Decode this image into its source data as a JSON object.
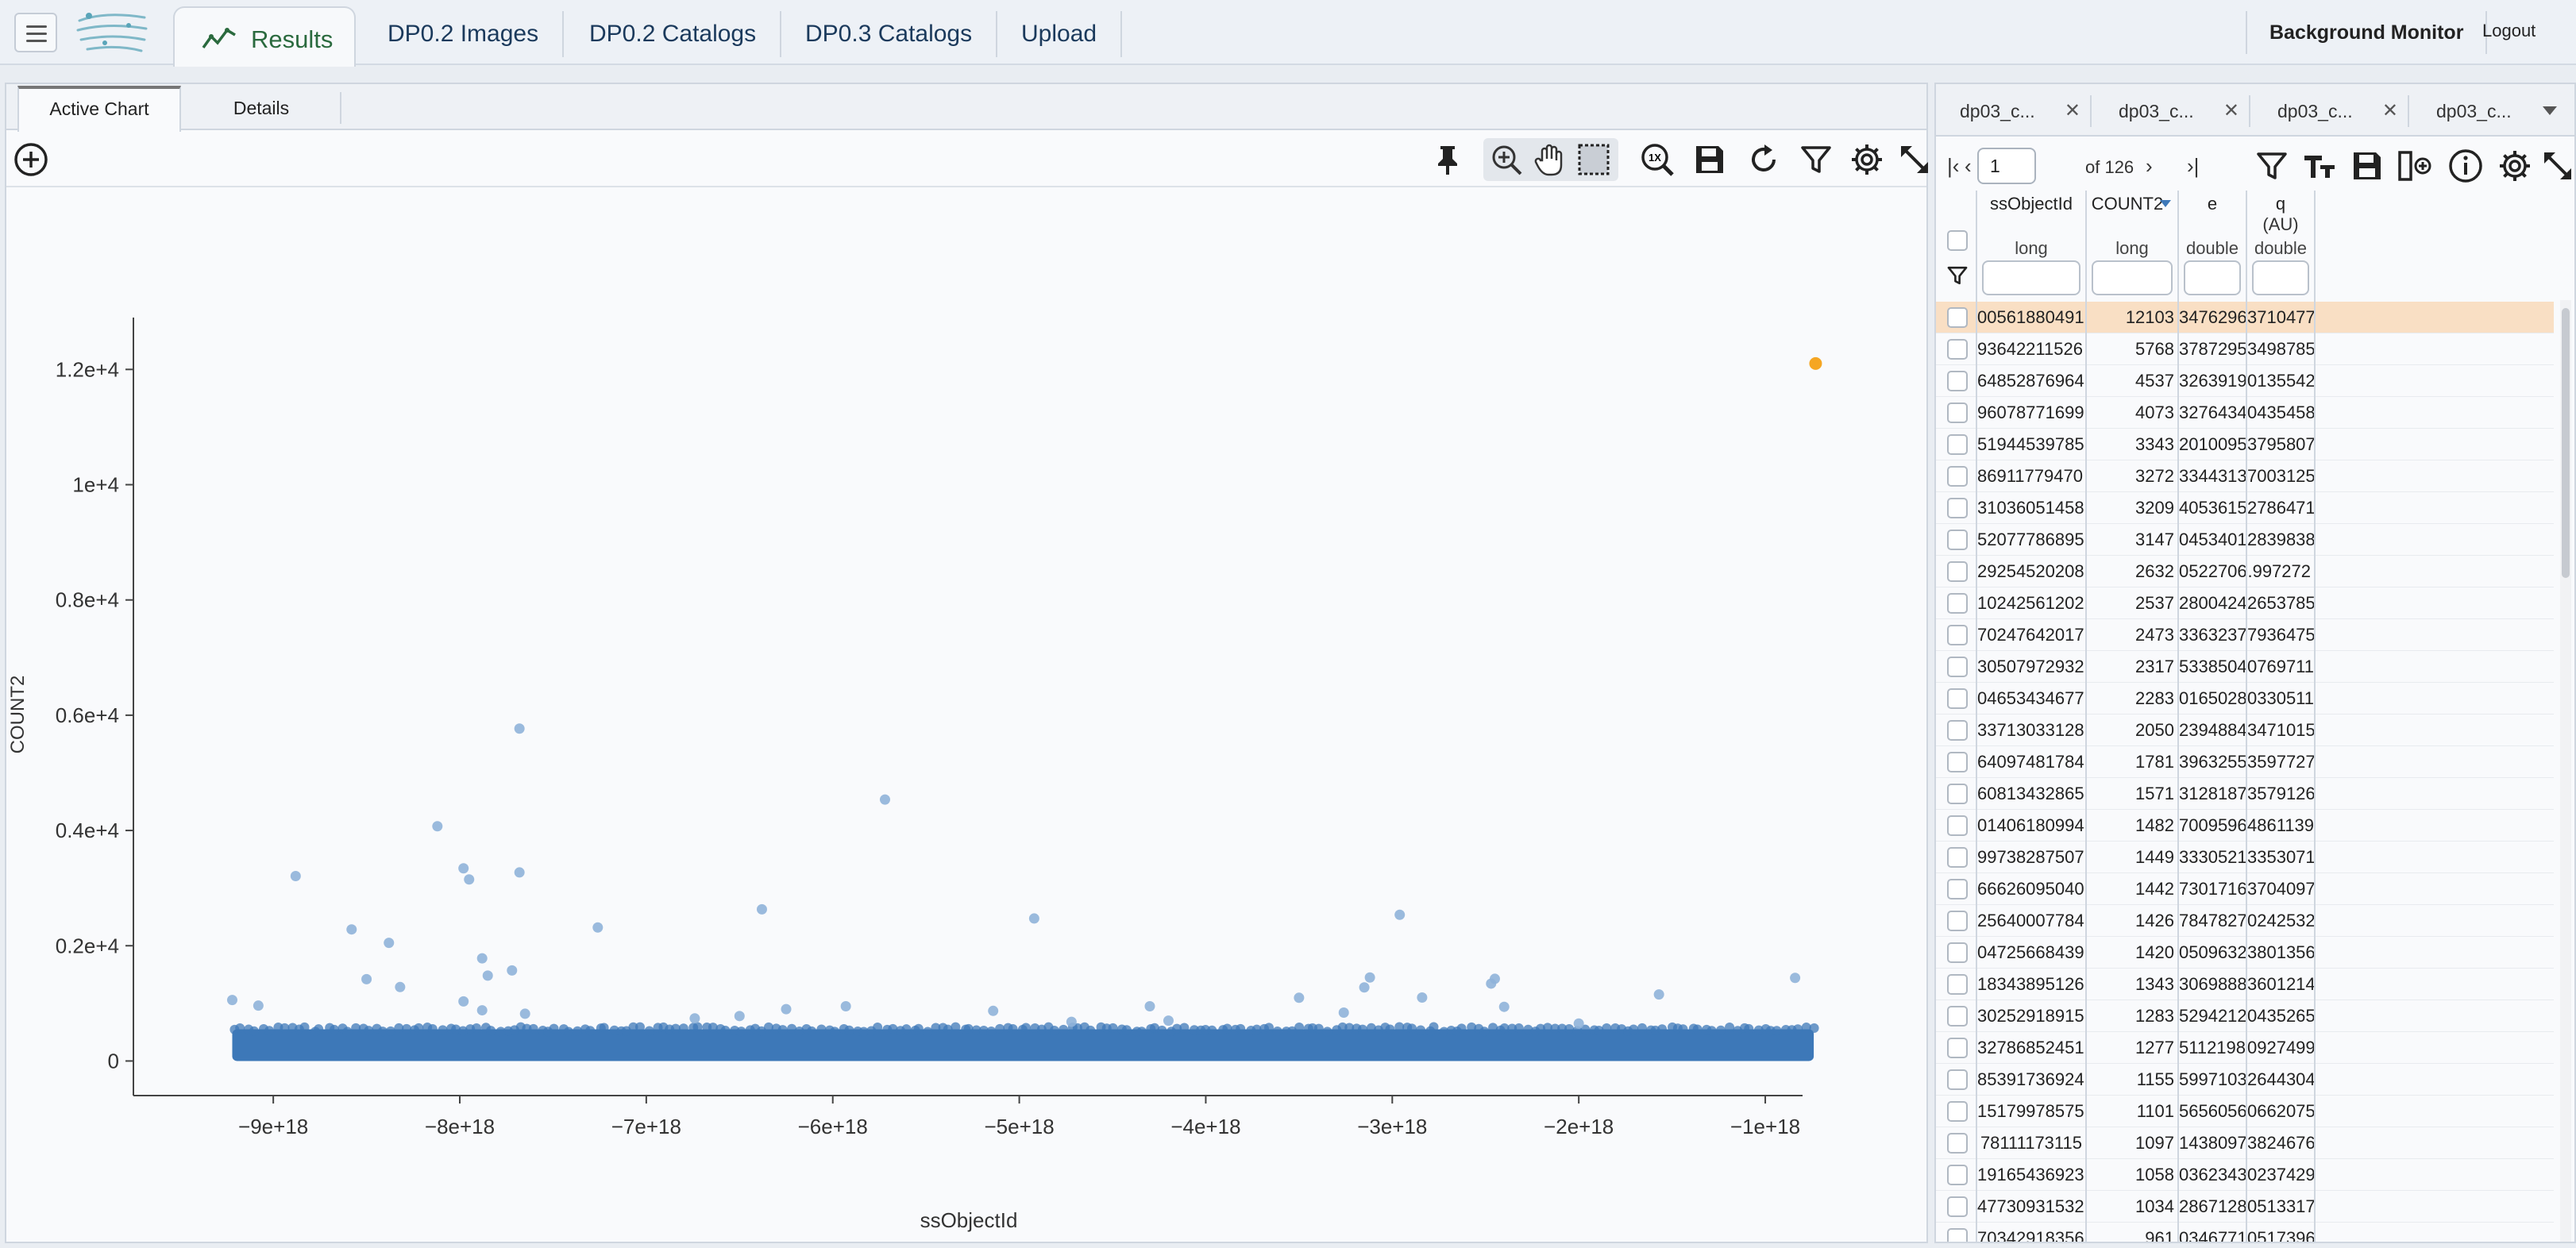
{
  "header": {
    "tabs": [
      {
        "label": "Results"
      },
      {
        "label": "DP0.2 Images"
      },
      {
        "label": "DP0.2 Catalogs"
      },
      {
        "label": "DP0.3 Catalogs"
      },
      {
        "label": "Upload"
      }
    ],
    "background_monitor": "Background Monitor",
    "logout": "Logout"
  },
  "left_panel": {
    "tabs": [
      {
        "label": "Active Chart"
      },
      {
        "label": "Details"
      }
    ],
    "toolbar_icons": [
      "add-chart-icon",
      "pin-icon",
      "zoom-icon",
      "pan-icon",
      "select-icon",
      "zoom-1x-icon",
      "save-icon",
      "restore-icon",
      "filter-icon",
      "settings-icon",
      "expand-icon"
    ]
  },
  "chart_data": {
    "type": "scatter",
    "xlabel": "ssObjectId",
    "ylabel": "COUNT2",
    "x_ticks": [
      "−9e+18",
      "−8e+18",
      "−7e+18",
      "−6e+18",
      "−5e+18",
      "−4e+18",
      "−3e+18",
      "−2e+18",
      "−1e+18"
    ],
    "x_tick_values": [
      -9e+18,
      -8e+18,
      -7e+18,
      -6e+18,
      -5e+18,
      -4e+18,
      -3e+18,
      -2e+18,
      -1e+18
    ],
    "y_ticks": [
      "0",
      "0.2e+4",
      "0.4e+4",
      "0.6e+4",
      "0.8e+4",
      "1e+4",
      "1.2e+4"
    ],
    "y_tick_values": [
      0,
      2000,
      4000,
      6000,
      8000,
      10000,
      12000
    ],
    "xlim": [
      -9.75e+18,
      -8e+17
    ],
    "ylim": [
      -600,
      12900
    ],
    "dense_band": {
      "x": [
        -9.22e+18,
        -7.4e+17
      ],
      "y": [
        0,
        550
      ]
    },
    "highlight_point": {
      "x": -7.3e+17,
      "y": 12103,
      "color": "#f5a623"
    },
    "point_color": "#3d78b8",
    "outliers": [
      {
        "x": -7.68e+18,
        "y": 5768
      },
      {
        "x": -5.72e+18,
        "y": 4537
      },
      {
        "x": -8.12e+18,
        "y": 4073
      },
      {
        "x": -7.98e+18,
        "y": 3343
      },
      {
        "x": -7.95e+18,
        "y": 3150
      },
      {
        "x": -7.68e+18,
        "y": 3272
      },
      {
        "x": -8.88e+18,
        "y": 3209
      },
      {
        "x": -6.38e+18,
        "y": 2632
      },
      {
        "x": -2.96e+18,
        "y": 2537
      },
      {
        "x": -4.92e+18,
        "y": 2473
      },
      {
        "x": -7.26e+18,
        "y": 2317
      },
      {
        "x": -8.58e+18,
        "y": 2283
      },
      {
        "x": -8.38e+18,
        "y": 2050
      },
      {
        "x": -7.88e+18,
        "y": 1781
      },
      {
        "x": -7.72e+18,
        "y": 1571
      },
      {
        "x": -7.85e+18,
        "y": 1482
      },
      {
        "x": -8.5e+18,
        "y": 1420
      },
      {
        "x": -3.12e+18,
        "y": 1449
      },
      {
        "x": -2.45e+18,
        "y": 1426
      },
      {
        "x": -8.4e+17,
        "y": 1442
      },
      {
        "x": -8.32e+18,
        "y": 1283
      },
      {
        "x": -3.15e+18,
        "y": 1277
      },
      {
        "x": -2.47e+18,
        "y": 1343
      },
      {
        "x": -1.57e+18,
        "y": 1155
      },
      {
        "x": -2.84e+18,
        "y": 1101
      },
      {
        "x": -3.5e+18,
        "y": 1097
      },
      {
        "x": -9.22e+18,
        "y": 1058
      },
      {
        "x": -7.98e+18,
        "y": 1034
      },
      {
        "x": -9.08e+18,
        "y": 961
      },
      {
        "x": -5.93e+18,
        "y": 950
      },
      {
        "x": -4.3e+18,
        "y": 950
      },
      {
        "x": -6.25e+18,
        "y": 900
      },
      {
        "x": -2.4e+18,
        "y": 940
      },
      {
        "x": -7.88e+18,
        "y": 880
      },
      {
        "x": -5.14e+18,
        "y": 870
      },
      {
        "x": -7.65e+18,
        "y": 820
      },
      {
        "x": -3.26e+18,
        "y": 840
      },
      {
        "x": -6.5e+18,
        "y": 780
      },
      {
        "x": -6.74e+18,
        "y": 740
      },
      {
        "x": -4.2e+18,
        "y": 700
      },
      {
        "x": -4.72e+18,
        "y": 680
      },
      {
        "x": -2e+18,
        "y": 650
      }
    ]
  },
  "right_panel": {
    "tabs": [
      {
        "label": "dp03_c..."
      },
      {
        "label": "dp03_c..."
      },
      {
        "label": "dp03_c..."
      },
      {
        "label": "dp03_c..."
      }
    ],
    "page_value": "1",
    "page_of": "of 126",
    "columns": [
      {
        "name": "ssObjectId",
        "type": "long",
        "unit": ""
      },
      {
        "name": "COUNT2",
        "type": "long",
        "unit": "",
        "sorted": "desc"
      },
      {
        "name": "e",
        "type": "double",
        "unit": ""
      },
      {
        "name": "q",
        "type": "double",
        "unit": "(AU)"
      }
    ],
    "rows": [
      [
        "00561880491",
        "12103",
        "3476296",
        "3710477"
      ],
      [
        "93642211526",
        "5768",
        "3787295",
        "3498785"
      ],
      [
        "64852876964",
        "4537",
        "3263919",
        "0135542"
      ],
      [
        "96078771699",
        "4073",
        "3276434",
        "0435458"
      ],
      [
        "51944539785",
        "3343",
        "2010095",
        "3795807"
      ],
      [
        "86911779470",
        "3272",
        "3344313",
        "7003125"
      ],
      [
        "31036051458",
        "3209",
        "4053615",
        "2786471"
      ],
      [
        "52077786895",
        "3147",
        "0453401",
        "2839838"
      ],
      [
        "29254520208",
        "2632",
        "0522706",
        ".997272"
      ],
      [
        "10242561202",
        "2537",
        "2800424",
        "2653785"
      ],
      [
        "70247642017",
        "2473",
        "3363237",
        "7936475"
      ],
      [
        "30507972932",
        "2317",
        "5338504",
        "0769711"
      ],
      [
        "04653434677",
        "2283",
        "0165028",
        "0330511"
      ],
      [
        "33713033128",
        "2050",
        "2394884",
        "3471015"
      ],
      [
        "64097481784",
        "1781",
        "3963255",
        "3597727"
      ],
      [
        "60813432865",
        "1571",
        "3128187",
        "3579126"
      ],
      [
        "01406180994",
        "1482",
        "7009596",
        "4861139"
      ],
      [
        "99738287507",
        "1449",
        "3330521",
        "3353071"
      ],
      [
        "66626095040",
        "1442",
        "7301716",
        "3704097"
      ],
      [
        "25640007784",
        "1426",
        "7847827",
        "0242532"
      ],
      [
        "04725668439",
        "1420",
        "0509632",
        "3801356"
      ],
      [
        "18343895126",
        "1343",
        "3069888",
        "3601214"
      ],
      [
        "30252918915",
        "1283",
        "5294212",
        "0435265"
      ],
      [
        "32786852451",
        "1277",
        "5112198",
        "0927499"
      ],
      [
        "85391736924",
        "1155",
        "5997103",
        "2644304"
      ],
      [
        "15179978575",
        "1101",
        "5656056",
        "0662075"
      ],
      [
        "78111173115",
        "1097",
        "1438097",
        "3824676"
      ],
      [
        "19165436923",
        "1058",
        "0362343",
        "0237429"
      ],
      [
        "47730931532",
        "1034",
        "2867128",
        "0513317"
      ],
      [
        "70342918356",
        "961",
        "0346771",
        "0517396"
      ]
    ]
  }
}
